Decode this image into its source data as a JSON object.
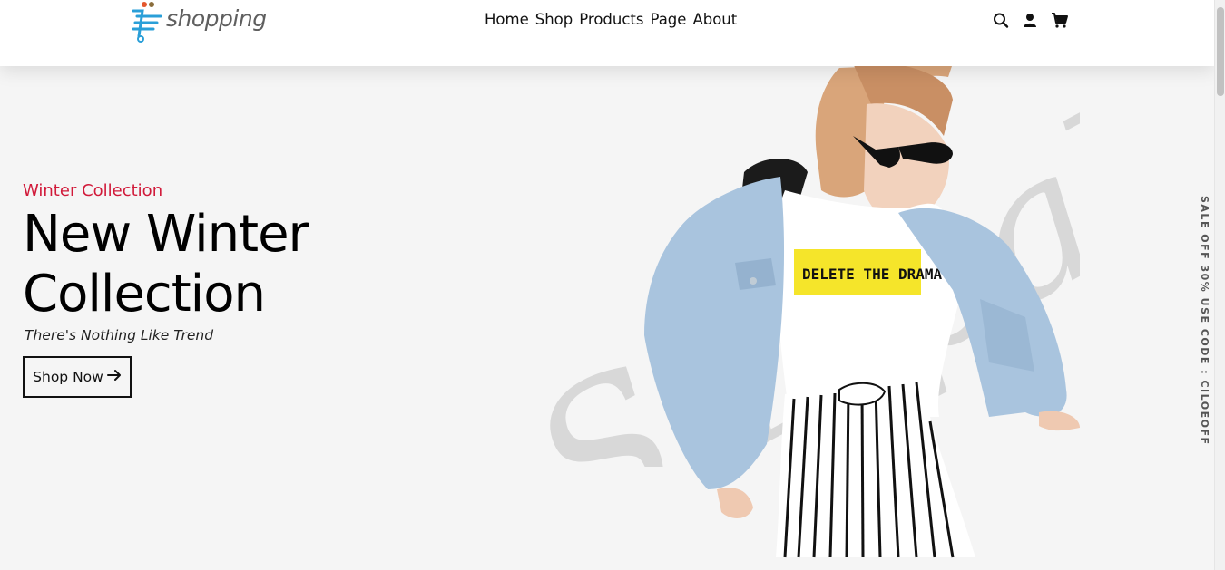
{
  "brand": {
    "name": "shopping"
  },
  "nav": {
    "items": [
      "Home",
      "Shop",
      "Products",
      "Page",
      "About"
    ]
  },
  "header_icons": [
    "search-icon",
    "user-icon",
    "cart-icon"
  ],
  "hero": {
    "subtitle": "Winter Collection",
    "title": "New Winter Collection",
    "tagline": "There's Nothing Like Trend",
    "button_label": "Shop Now",
    "button_icon": "arrow-right-icon",
    "watermark_text": "Shopalis",
    "tshirt_print": "DELETE THE DRAMA"
  },
  "promo_vertical": "SALE OFF 30% USE CODE : CILOEOFF",
  "colors": {
    "accent": "#d11a3a",
    "text": "#000000",
    "background": "#f5f5f5",
    "logo_blue": "#2a9fd8"
  }
}
